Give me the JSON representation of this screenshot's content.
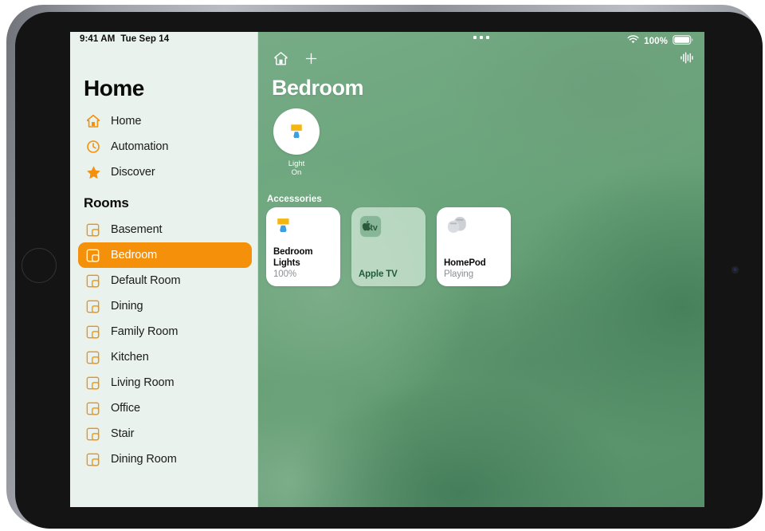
{
  "status_bar": {
    "time": "9:41 AM",
    "date": "Tue Sep 14",
    "battery_percent": "100%",
    "wifi_icon": "wifi-icon",
    "battery_icon": "battery-full-icon"
  },
  "sidebar": {
    "title": "Home",
    "nav_items": [
      {
        "label": "Home",
        "icon": "house-icon"
      },
      {
        "label": "Automation",
        "icon": "clock-icon"
      },
      {
        "label": "Discover",
        "icon": "star-icon"
      }
    ],
    "rooms_header": "Rooms",
    "rooms": [
      {
        "label": "Basement",
        "icon": "room-icon",
        "selected": false
      },
      {
        "label": "Bedroom",
        "icon": "room-icon",
        "selected": true
      },
      {
        "label": "Default Room",
        "icon": "room-icon",
        "selected": false
      },
      {
        "label": "Dining",
        "icon": "room-icon",
        "selected": false
      },
      {
        "label": "Family Room",
        "icon": "room-icon",
        "selected": false
      },
      {
        "label": "Kitchen",
        "icon": "room-icon",
        "selected": false
      },
      {
        "label": "Living Room",
        "icon": "room-icon",
        "selected": false
      },
      {
        "label": "Office",
        "icon": "room-icon",
        "selected": false
      },
      {
        "label": "Stair",
        "icon": "room-icon",
        "selected": false
      },
      {
        "label": "Dining Room",
        "icon": "room-icon",
        "selected": false
      }
    ]
  },
  "main": {
    "toolbar": {
      "home_icon": "house-icon",
      "add_icon": "plus-icon",
      "audio_icon": "audio-waveform-icon",
      "multitask_icon": "multitask-dots-icon"
    },
    "room_title": "Bedroom",
    "scene_tile": {
      "icon": "lamp-icon",
      "name": "Light",
      "state": "On"
    },
    "accessories_header": "Accessories",
    "accessories": [
      {
        "name": "Bedroom Lights",
        "name_line1": "Bedroom",
        "name_line2": "Lights",
        "state": "100%",
        "icon": "lamp-icon",
        "active": true
      },
      {
        "name": "Apple TV",
        "name_line1": "Apple TV",
        "name_line2": "",
        "state": "",
        "icon": "apple-tv-icon",
        "active": false
      },
      {
        "name": "HomePod",
        "name_line1": "HomePod",
        "name_line2": "",
        "state": "Playing",
        "icon": "homepod-icon",
        "active": true
      }
    ]
  },
  "colors": {
    "accent_orange": "#f5900b",
    "sidebar_bg": "#e9f2ec",
    "wallpaper_green": "#6ba57c",
    "lamp_shade": "#f5b611",
    "lamp_base": "#3e9fe0"
  }
}
